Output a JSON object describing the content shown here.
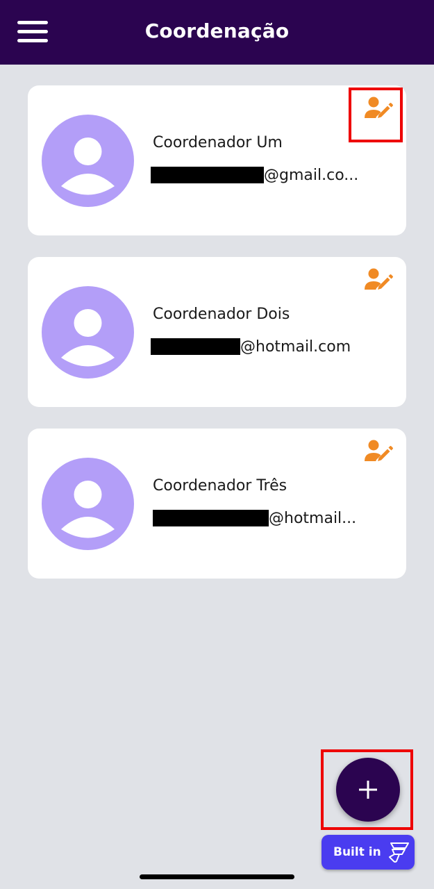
{
  "appbar": {
    "title": "Coordenação",
    "menu_icon": "hamburger-menu-icon",
    "background_color": "#2b0450"
  },
  "coordinators": [
    {
      "name": "Coordenador Um",
      "email_visible": "@gmail.co...",
      "email_redacted": true,
      "avatar_icon": "person-icon",
      "edit_icon": "user-edit-icon"
    },
    {
      "name": "Coordenador Dois",
      "email_visible": "@hotmail.com",
      "email_redacted": true,
      "avatar_icon": "person-icon",
      "edit_icon": "user-edit-icon"
    },
    {
      "name": "Coordenador Três",
      "email_visible": "@hotmail...",
      "email_redacted": true,
      "avatar_icon": "person-icon",
      "edit_icon": "user-edit-icon"
    }
  ],
  "fab": {
    "icon": "plus-icon"
  },
  "badge": {
    "label": "Built in",
    "icon": "flutterflow-logo-icon"
  },
  "colors": {
    "accent_orange": "#f08a24",
    "avatar_purple": "#b39ef8",
    "page_background": "#e0e2e7",
    "highlight_red": "#ee0000",
    "badge_blue": "#4a3cf0"
  }
}
